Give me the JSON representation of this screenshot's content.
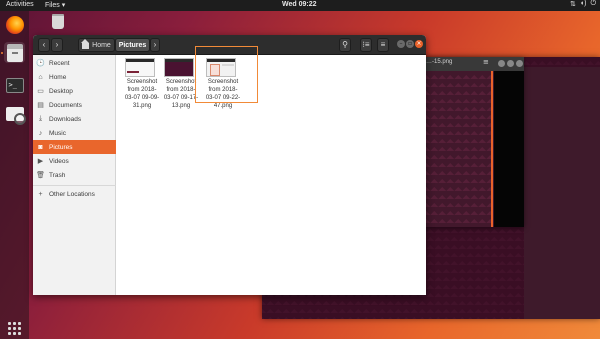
{
  "topbar": {
    "activities": "Activities",
    "app_menu": "Files ▾",
    "clock": "Wed 09:22",
    "status_icons": [
      "network-icon",
      "volume-icon",
      "power-icon"
    ]
  },
  "dock": {
    "items": [
      "firefox-icon",
      "files-icon",
      "terminal-icon",
      "screenshot-icon",
      "show-apps-icon"
    ]
  },
  "background_window": {
    "title": "…-15.png",
    "menu_glyph": "≡"
  },
  "files_window": {
    "header": {
      "back": "‹",
      "forward": "›",
      "breadcrumb_home": "Home",
      "breadcrumb_current": "Pictures",
      "breadcrumb_next": "›",
      "search_glyph": "⚲",
      "view_glyph": "⁝≡",
      "menu_glyph": "≡",
      "minimize": "–",
      "maximize": "▫",
      "close": "×"
    },
    "sidebar": [
      {
        "label": "Recent",
        "icon": "🕒",
        "selected": false
      },
      {
        "label": "Home",
        "icon": "⌂",
        "selected": false
      },
      {
        "label": "Desktop",
        "icon": "▭",
        "selected": false
      },
      {
        "label": "Documents",
        "icon": "▤",
        "selected": false
      },
      {
        "label": "Downloads",
        "icon": "⤓",
        "selected": false
      },
      {
        "label": "Music",
        "icon": "♪",
        "selected": false
      },
      {
        "label": "Pictures",
        "icon": "◙",
        "selected": true
      },
      {
        "label": "Videos",
        "icon": "▶",
        "selected": false
      },
      {
        "label": "Trash",
        "icon": "🗑",
        "selected": false
      },
      {
        "label": "Other Locations",
        "icon": "+",
        "selected": false
      }
    ],
    "files": [
      {
        "line1": "Screenshot",
        "line2": "from 2018-",
        "line3": "03-07 09-09-",
        "line4": "31.png"
      },
      {
        "line1": "Screenshot",
        "line2": "from 2018-",
        "line3": "03-07 09-17-",
        "line4": "13.png"
      },
      {
        "line1": "Screenshot",
        "line2": "from 2018-",
        "line3": "03-07 09-22-",
        "line4": "47.png"
      }
    ]
  },
  "colors": {
    "accent": "#e9662c",
    "headerbar": "#2d2d2d",
    "topbar": "#1d1d1d"
  }
}
